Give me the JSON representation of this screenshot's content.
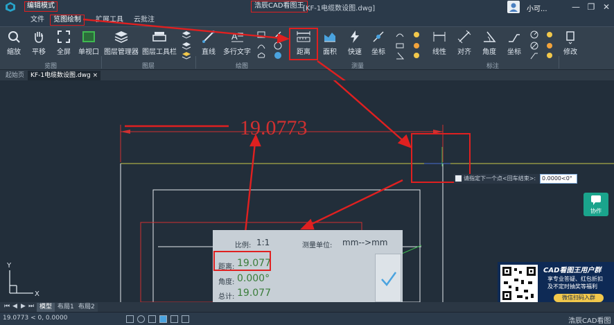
{
  "titlebar": {
    "mode": "编辑模式",
    "app_name": "浩辰CAD看图王",
    "file": "[KF-1电缆数设图.dwg]",
    "user": "小可..."
  },
  "menu": [
    "文件",
    "览图绘制",
    "扩展工具",
    "云批注"
  ],
  "ribbon": {
    "view": [
      "缩放",
      "平移",
      "全屏",
      "单视口"
    ],
    "layer": [
      "图层管理器",
      "图层工具栏"
    ],
    "draw": [
      "直线",
      "多行文字"
    ],
    "measure": [
      "距离",
      "面积",
      "快速",
      "坐标"
    ],
    "annotate": [
      "线性",
      "对齐",
      "角度",
      "坐标"
    ],
    "modify": "修改",
    "groups": [
      "览图",
      "图层",
      "绘图",
      "测量",
      "标注"
    ]
  },
  "tabs": [
    "起始页",
    "KF-1电缆数设图.dwg"
  ],
  "canvas": {
    "dimension_value": "19.0773",
    "prompt": "请指定下一个点<回车结束>:",
    "prompt_input": "0.0000<0°",
    "collab_label": "协作"
  },
  "measure_panel": {
    "scale_label": "比例:",
    "scale_value": "1:1",
    "unit_label": "测量单位:",
    "unit_value": "mm-->mm",
    "distance_label": "距离:",
    "distance_value": "19.077",
    "angle_label": "角度:",
    "angle_value": "0.000°",
    "total_label": "总计:",
    "total_value": "19.077"
  },
  "promo": {
    "title": "CAD看图王用户群",
    "line1": "享专业答疑、红包折扣",
    "line2": "及不定时抽奖等福利",
    "button": "微信扫码入群"
  },
  "layouts": [
    "模型",
    "布局1",
    "布局2"
  ],
  "status": {
    "coords": "19.0773 < 0, 0.0000",
    "brand": "浩辰CAD看图王"
  },
  "colors": {
    "annotation": "#e02020",
    "accent": "#1aa48c"
  }
}
